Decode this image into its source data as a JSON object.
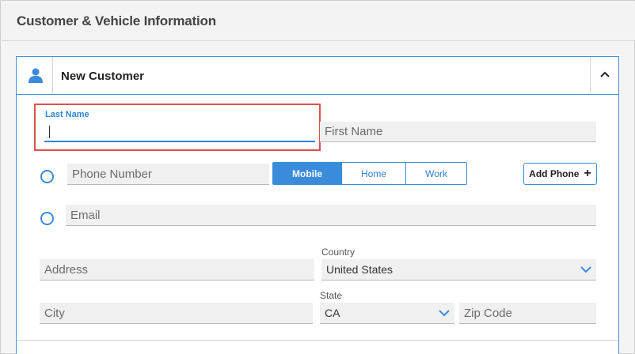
{
  "window": {
    "title": "Customer & Vehicle Information"
  },
  "panel": {
    "title": "New Customer",
    "icon": "person-icon",
    "collapse_icon": "chevron-up-icon"
  },
  "form": {
    "last_name": {
      "label": "Last Name",
      "value": ""
    },
    "first_name": {
      "placeholder": "First Name",
      "value": ""
    },
    "phone": {
      "placeholder": "Phone Number",
      "value": ""
    },
    "phone_types": [
      "Mobile",
      "Home",
      "Work"
    ],
    "phone_type_selected": "Mobile",
    "add_phone_label": "Add Phone",
    "email": {
      "placeholder": "Email",
      "value": ""
    },
    "address": {
      "placeholder": "Address",
      "value": ""
    },
    "country": {
      "label": "Country",
      "value": "United States"
    },
    "city": {
      "placeholder": "City",
      "value": ""
    },
    "state": {
      "label": "State",
      "value": "CA"
    },
    "zip": {
      "placeholder": "Zip Code",
      "value": ""
    }
  },
  "colors": {
    "accent": "#3b8bdb",
    "highlight_border": "#d9534f"
  }
}
